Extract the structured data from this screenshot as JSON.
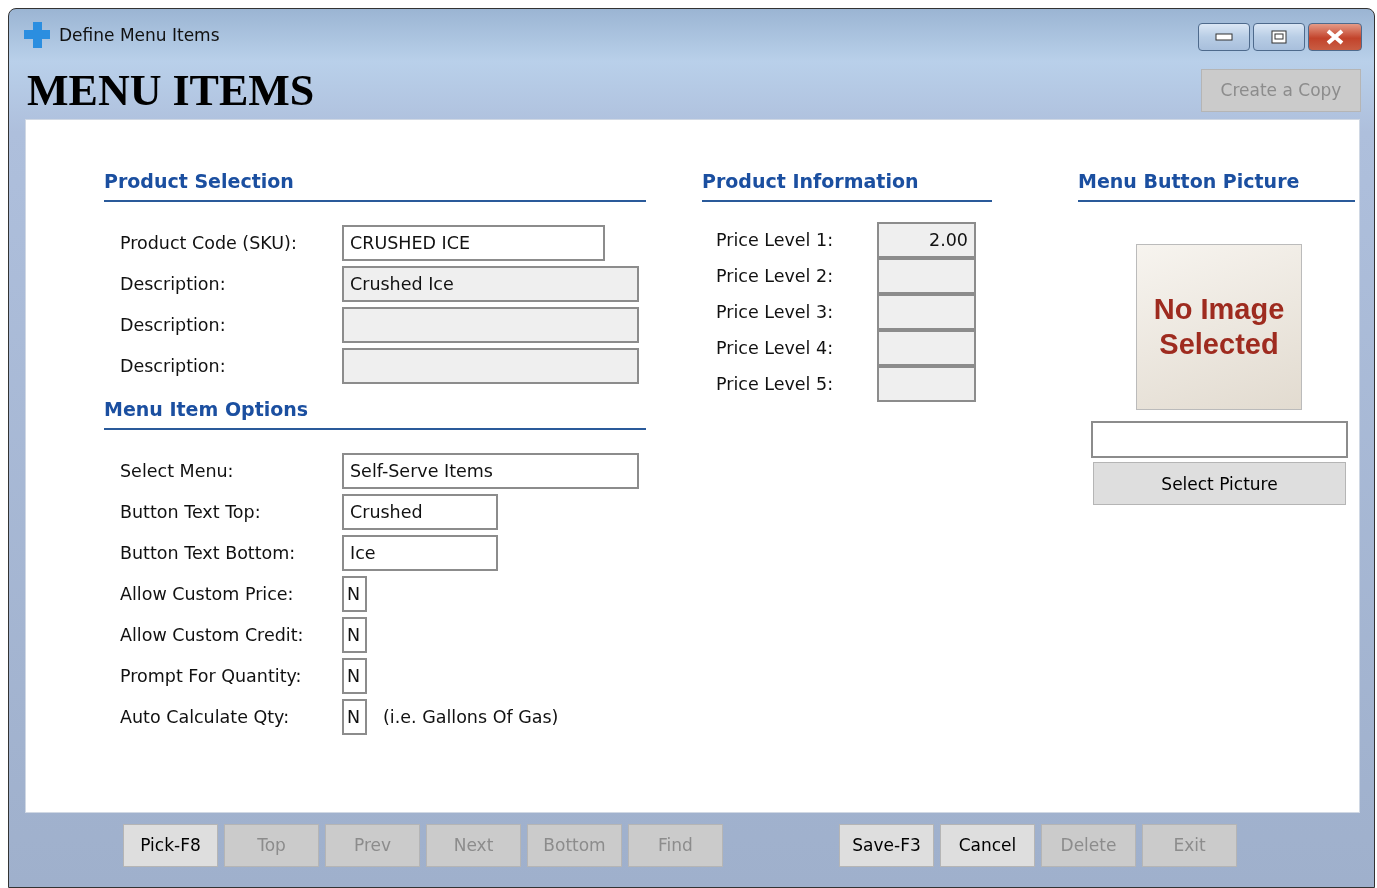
{
  "window": {
    "title": "Define Menu Items"
  },
  "header": {
    "title": "MENU ITEMS",
    "copy_button": {
      "label": "Create a Copy",
      "disabled": true
    }
  },
  "product_selection": {
    "heading": "Product Selection",
    "fields": [
      {
        "label": "Product Code (SKU):",
        "value": "CRUSHED ICE",
        "disabled": false
      },
      {
        "label": "Description:",
        "value": "Crushed Ice",
        "disabled": true
      },
      {
        "label": "Description:",
        "disabled": true
      },
      {
        "label": "Description:",
        "disabled": true
      }
    ]
  },
  "menu_item_options": {
    "heading": "Menu Item Options",
    "fields": [
      {
        "label": "Select Menu:",
        "value": "Self-Serve Items",
        "kind": "long"
      },
      {
        "label": "Button Text Top:",
        "value": "Crushed",
        "kind": "medium"
      },
      {
        "label": "Button Text Bottom:",
        "value": "Ice",
        "kind": "medium"
      },
      {
        "label": "Allow Custom Price:",
        "value": "N",
        "kind": "flag"
      },
      {
        "label": "Allow Custom Credit:",
        "value": "N",
        "kind": "flag"
      },
      {
        "label": "Prompt For Quantity:",
        "value": "N",
        "kind": "flag"
      },
      {
        "label": "Auto Calculate Qty:",
        "value": "N",
        "kind": "flag",
        "note": "(i.e. Gallons Of Gas)"
      }
    ]
  },
  "product_information": {
    "heading": "Product Information",
    "prices": [
      {
        "label": "Price Level 1:",
        "value": "2.00"
      },
      {
        "label": "Price Level 2:"
      },
      {
        "label": "Price Level 3:"
      },
      {
        "label": "Price Level 4:"
      },
      {
        "label": "Price Level 5:"
      }
    ]
  },
  "menu_button_picture": {
    "heading": "Menu Button Picture",
    "placeholder_text": "No Image Selected",
    "button": "Select Picture"
  },
  "toolbar": {
    "left": [
      {
        "label": "Pick-F8",
        "disabled": false
      },
      {
        "label": "Top",
        "disabled": true
      },
      {
        "label": "Prev",
        "disabled": true
      },
      {
        "label": "Next",
        "disabled": true
      },
      {
        "label": "Bottom",
        "disabled": true
      },
      {
        "label": "Find",
        "disabled": true
      }
    ],
    "right": [
      {
        "label": "Save-F3",
        "disabled": false
      },
      {
        "label": "Cancel",
        "disabled": false
      },
      {
        "label": "Delete",
        "disabled": true
      },
      {
        "label": "Exit",
        "disabled": true
      }
    ]
  }
}
